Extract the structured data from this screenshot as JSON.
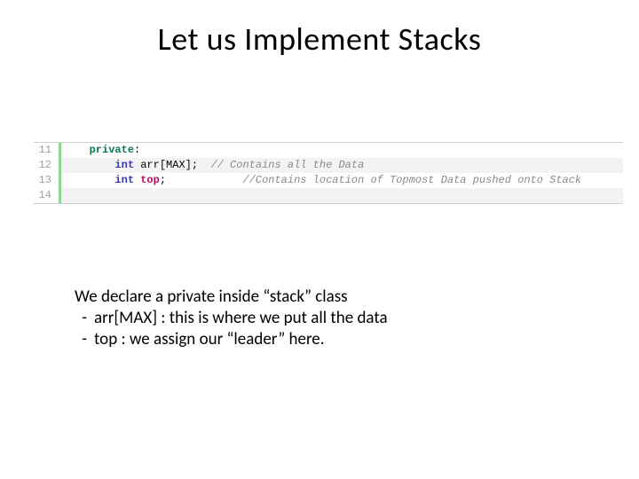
{
  "title": "Let us Implement Stacks",
  "code": {
    "lines": [
      {
        "num": "11",
        "ind": "   ",
        "tokens": [
          {
            "cls": "kw",
            "t": "private"
          },
          {
            "cls": "",
            "t": ":"
          }
        ]
      },
      {
        "num": "12",
        "ind": "       ",
        "tokens": [
          {
            "cls": "typ",
            "t": "int"
          },
          {
            "cls": "",
            "t": " arr[MAX];  "
          },
          {
            "cls": "cmt",
            "t": "// Contains all the Data"
          }
        ]
      },
      {
        "num": "13",
        "ind": "       ",
        "tokens": [
          {
            "cls": "typ",
            "t": "int"
          },
          {
            "cls": "",
            "t": " "
          },
          {
            "cls": "idm",
            "t": "top"
          },
          {
            "cls": "",
            "t": ";            "
          },
          {
            "cls": "cmt",
            "t": "//Contains location of Topmost Data pushed onto Stack"
          }
        ]
      },
      {
        "num": "14",
        "ind": "",
        "tokens": []
      }
    ]
  },
  "explain": {
    "intro": "We declare a private inside “stack” class",
    "bullets": [
      "arr[MAX] : this is where we put all the data",
      "top : we assign our “leader” here."
    ]
  }
}
